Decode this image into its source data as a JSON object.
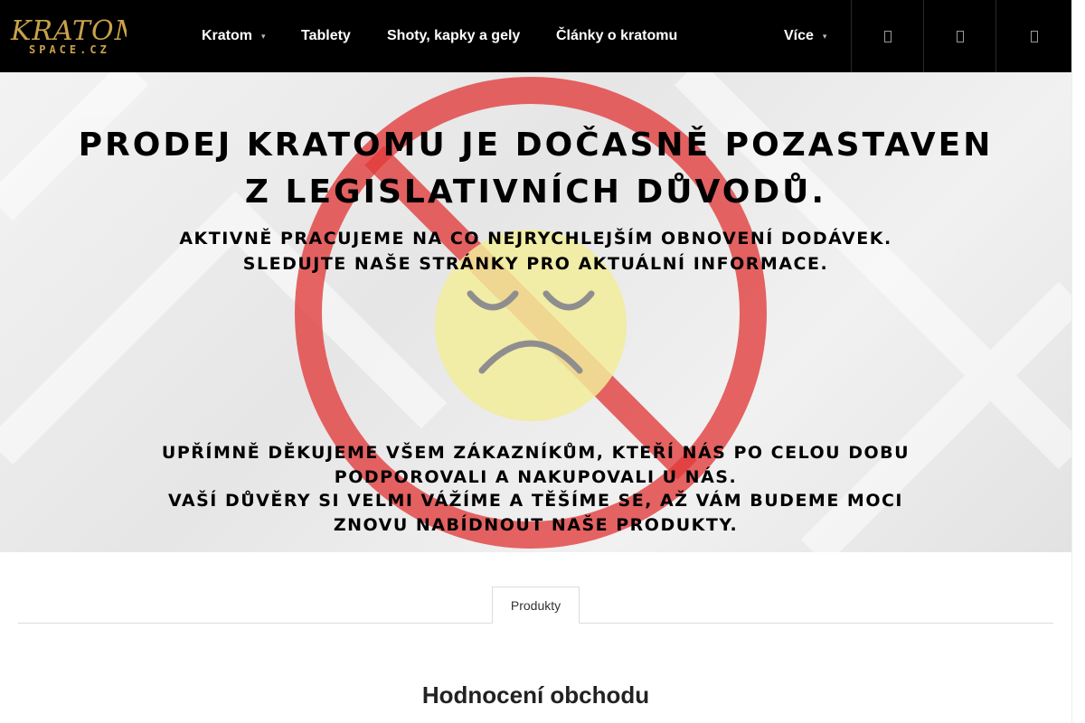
{
  "header": {
    "logo_text": "KRATOM",
    "logo_subtext": "SPACE.CZ",
    "nav": [
      {
        "label": "Kratom",
        "has_dropdown": true
      },
      {
        "label": "Tablety",
        "has_dropdown": false
      },
      {
        "label": "Shoty, kapky a gely",
        "has_dropdown": false
      },
      {
        "label": "Články o kratomu",
        "has_dropdown": false
      },
      {
        "label": "Více",
        "has_dropdown": true
      }
    ],
    "icons": [
      "search-icon",
      "user-icon",
      "cart-icon"
    ],
    "colors": {
      "background": "#000000",
      "text": "#ffffff",
      "logo_gold": "#c9a24a"
    }
  },
  "banner": {
    "title_lines": [
      "PRODEJ KRATOMU JE DOČASNĚ POZASTAVEN",
      "Z LEGISLATIVNÍCH DŮVODŮ."
    ],
    "subtitle_lines": [
      "AKTIVNĚ PRACUJEME NA CO NEJRYCHLEJŠÍM OBNOVENÍ DODÁVEK.",
      "SLEDUJTE NAŠE STRÁNKY PRO AKTUÁLNÍ INFORMACE."
    ],
    "thanks_lines": [
      "UPŘÍMNĚ DĚKUJEME VŠEM ZÁKAZNÍKŮM, KTEŘÍ NÁS PO CELOU DOBU",
      "PODPOROVALI A NAKUPOVALI U NÁS.",
      "VAŠÍ DŮVĚRY SI VELMI VÁŽÍME A TĚŠÍME SE, AŽ VÁM BUDEME MOCI",
      "ZNOVU NABÍDNOUT NAŠE PRODUKTY."
    ],
    "icons": [
      "prohibited-icon",
      "sad-face-icon"
    ],
    "colors": {
      "prohibited": "#e23a3a",
      "face": "#f2ec9a"
    }
  },
  "tabs": [
    {
      "label": "Produkty",
      "active": true
    }
  ],
  "section": {
    "title": "Hodnocení obchodu"
  }
}
